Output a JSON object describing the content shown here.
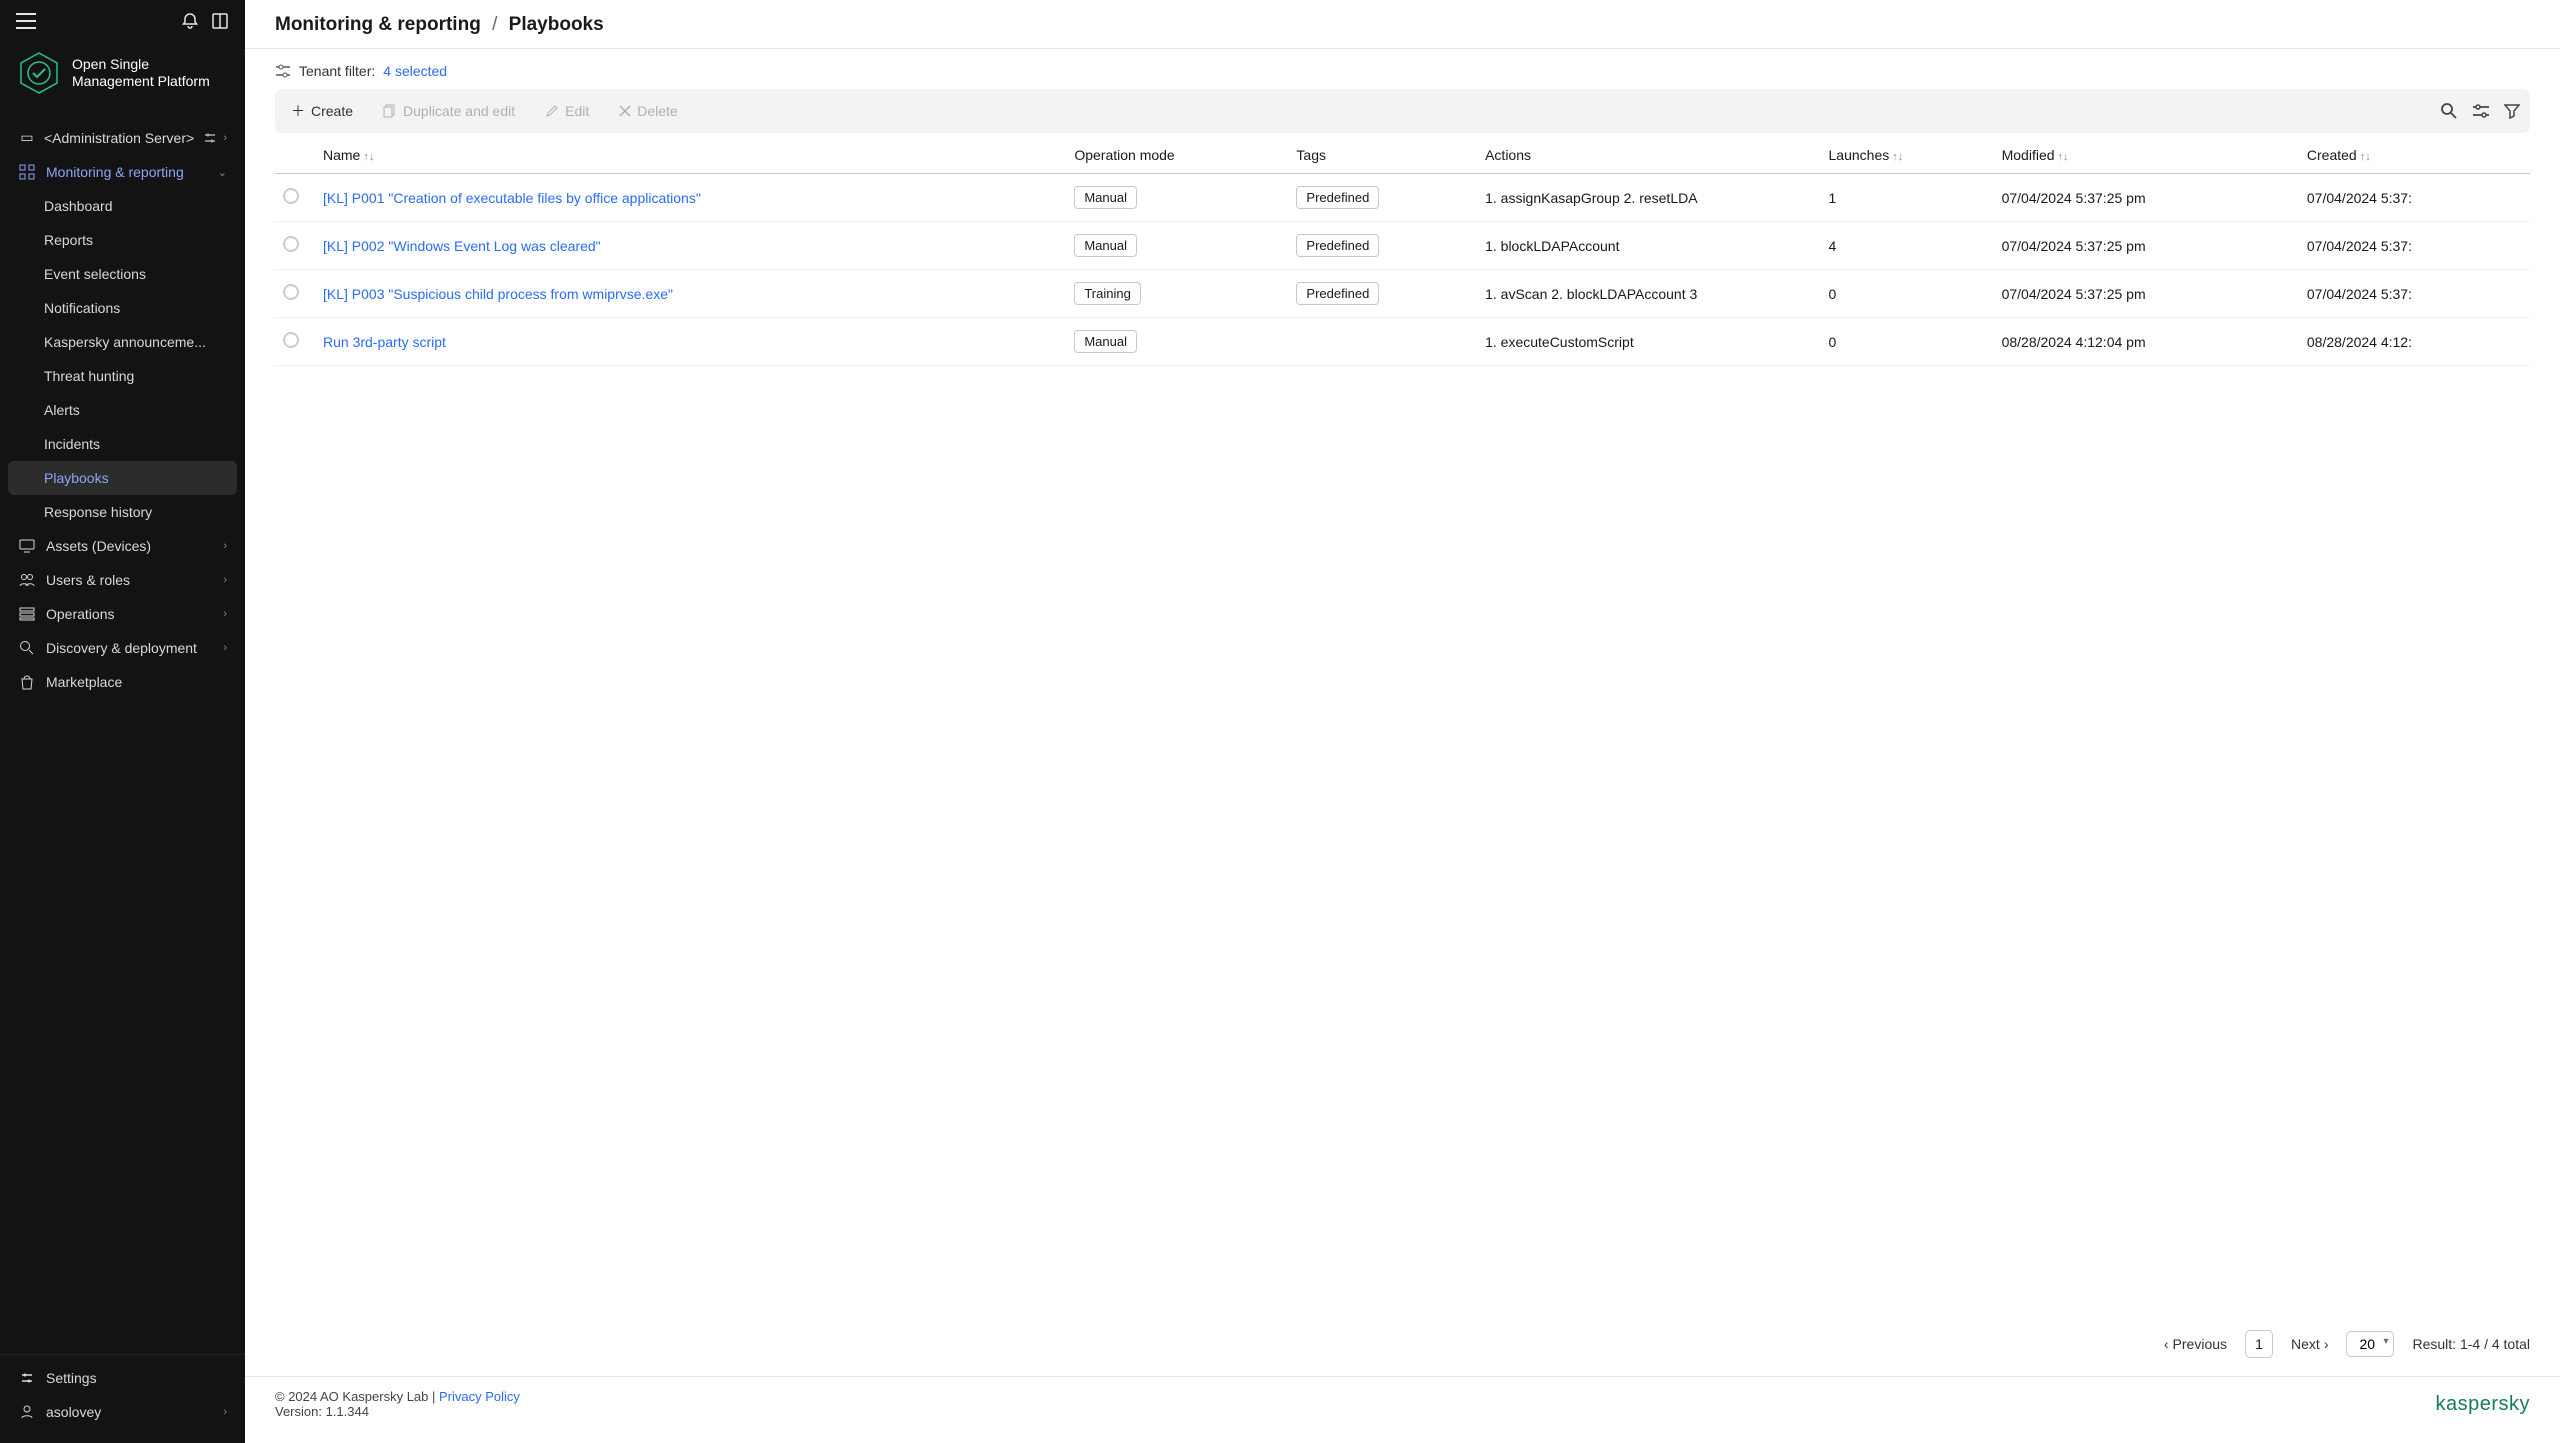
{
  "brand": {
    "line1": "Open Single",
    "line2": "Management Platform"
  },
  "admin_server": "<Administration Server>",
  "nav": {
    "monitoring": "Monitoring & reporting",
    "sub": {
      "dashboard": "Dashboard",
      "reports": "Reports",
      "event_selections": "Event selections",
      "notifications": "Notifications",
      "announcements": "Kaspersky announceme...",
      "threat_hunting": "Threat hunting",
      "alerts": "Alerts",
      "incidents": "Incidents",
      "playbooks": "Playbooks",
      "response_history": "Response history"
    },
    "assets": "Assets (Devices)",
    "users": "Users & roles",
    "operations": "Operations",
    "discovery": "Discovery & deployment",
    "marketplace": "Marketplace",
    "settings": "Settings",
    "user": "asolovey"
  },
  "breadcrumb": {
    "parent": "Monitoring & reporting",
    "current": "Playbooks"
  },
  "tenant_filter": {
    "label": "Tenant filter:",
    "value": "4 selected"
  },
  "toolbar": {
    "create": "Create",
    "duplicate": "Duplicate and edit",
    "edit": "Edit",
    "delete": "Delete"
  },
  "columns": {
    "name": "Name",
    "operation_mode": "Operation mode",
    "tags": "Tags",
    "actions": "Actions",
    "launches": "Launches",
    "modified": "Modified",
    "created": "Created"
  },
  "rows": [
    {
      "name": "[KL] P001 \"Creation of executable files by office applications\"",
      "mode": "Manual",
      "tag": "Predefined",
      "actions": "1. assignKasapGroup 2. resetLDA",
      "launches": "1",
      "modified": "07/04/2024 5:37:25 pm",
      "created": "07/04/2024 5:37:"
    },
    {
      "name": "[KL] P002 \"Windows Event Log was cleared\"",
      "mode": "Manual",
      "tag": "Predefined",
      "actions": "1. blockLDAPAccount",
      "launches": "4",
      "modified": "07/04/2024 5:37:25 pm",
      "created": "07/04/2024 5:37:"
    },
    {
      "name": "[KL] P003 \"Suspicious child process from wmiprvse.exe\"",
      "mode": "Training",
      "tag": "Predefined",
      "actions": "1. avScan 2. blockLDAPAccount 3",
      "launches": "0",
      "modified": "07/04/2024 5:37:25 pm",
      "created": "07/04/2024 5:37:"
    },
    {
      "name": "Run 3rd-party script",
      "mode": "Manual",
      "tag": "",
      "actions": "1. executeCustomScript",
      "launches": "0",
      "modified": "08/28/2024 4:12:04 pm",
      "created": "08/28/2024 4:12:"
    }
  ],
  "pager": {
    "previous": "Previous",
    "page": "1",
    "next": "Next",
    "size": "20",
    "result": "Result: 1-4 / 4 total"
  },
  "footer": {
    "copyright": "© 2024 AO Kaspersky Lab",
    "sep": " | ",
    "privacy": "Privacy Policy",
    "version": "Version: 1.1.344",
    "brand": "kaspersky"
  }
}
